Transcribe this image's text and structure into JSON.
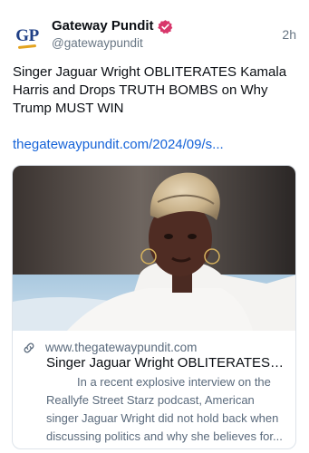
{
  "author": {
    "display_name": "Gateway Pundit",
    "handle": "@gatewaypundit",
    "avatar_text": "GP",
    "verified": true,
    "timestamp": "2h"
  },
  "post": {
    "text": "Singer Jaguar Wright OBLITERATES Kamala Harris and Drops TRUTH BOMBS on Why Trump MUST WIN",
    "link": "thegatewaypundit.com/2024/09/s..."
  },
  "card": {
    "domain": "www.thegatewaypundit.com",
    "title": "Singer Jaguar Wright OBLITERATES K...",
    "description": "In a recent explosive interview on the Reallyfe Street Starz podcast, American singer Jaguar Wright did not hold back when discussing politics and why she believes for...",
    "link_icon": "link-icon"
  },
  "colors": {
    "accent_link": "#1563d8",
    "verified_badge": "#d8376b",
    "brand_blue": "#1f3f86",
    "brand_gold": "#e3a31f"
  }
}
